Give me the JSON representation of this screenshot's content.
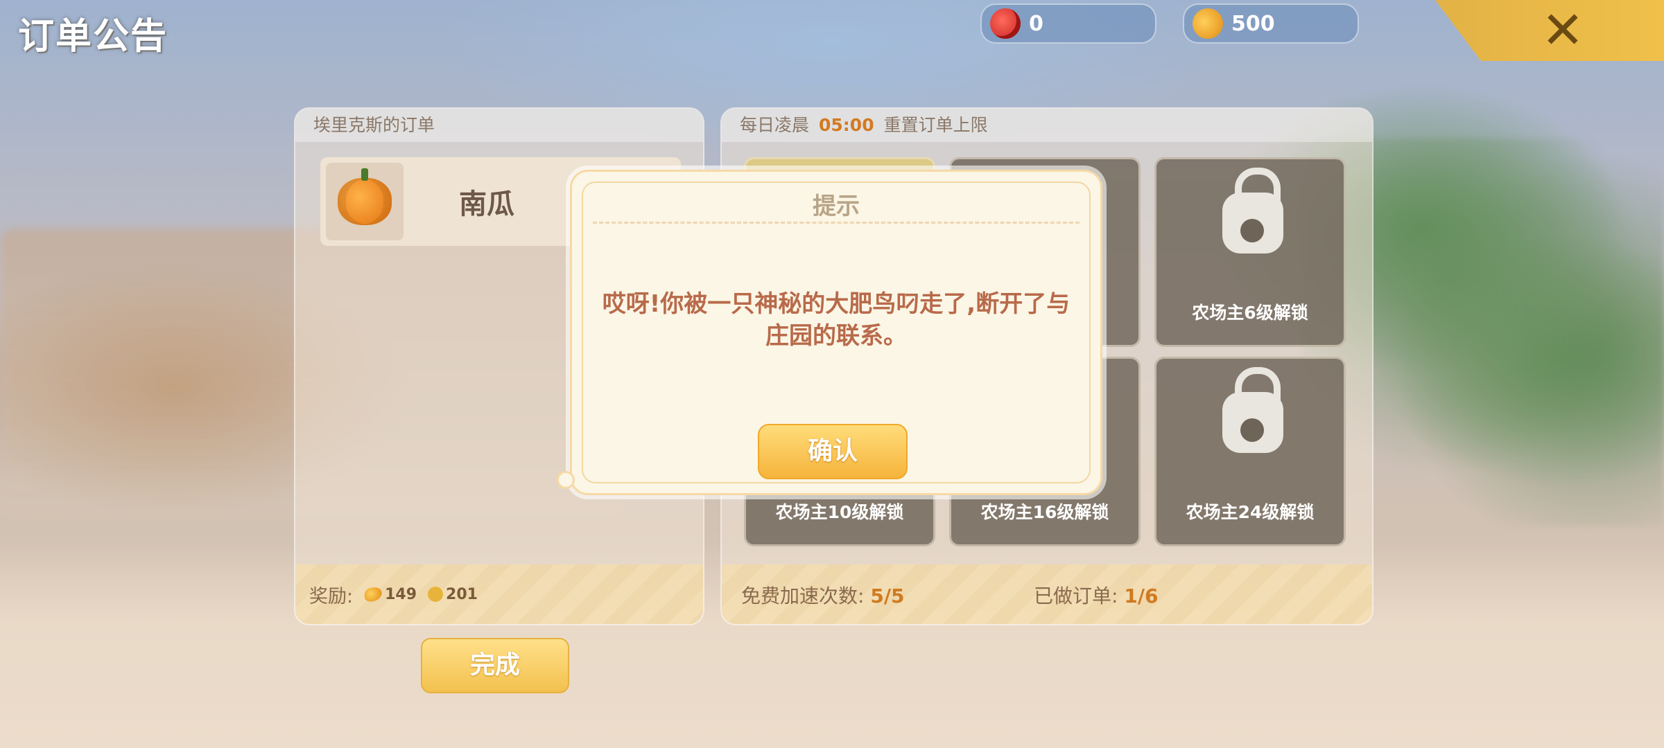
{
  "header": {
    "title": "订单公告",
    "currency_apple": "0",
    "currency_coin": "500",
    "close_label": "✕"
  },
  "order_panel": {
    "heading": "埃里克斯的订单",
    "item_name": "南瓜",
    "reward_label": "奖励:",
    "reward_coin": "149",
    "reward_xp": "201",
    "complete_button": "完成"
  },
  "slots_panel": {
    "heading_prefix": "每日凌晨",
    "heading_time": "05:00",
    "heading_suffix": "重置订单上限",
    "slots": [
      {
        "label": "农场主6级解锁"
      },
      {
        "label": "农场主10级解锁"
      },
      {
        "label": "农场主16级解锁"
      },
      {
        "label": "农场主24级解锁"
      }
    ],
    "free_speed_label": "免费加速次数:",
    "free_speed_value": "5/5",
    "orders_done_label": "已做订单:",
    "orders_done_value": "1/6"
  },
  "dialog": {
    "title": "提示",
    "message": "哎呀!你被一只神秘的大肥鸟叼走了,断开了与庄园的联系。",
    "confirm_button": "确认"
  },
  "colors": {
    "accent_orange": "#d47a20",
    "gold_button": "#f6b43c",
    "dialog_text": "#b86a4a"
  }
}
